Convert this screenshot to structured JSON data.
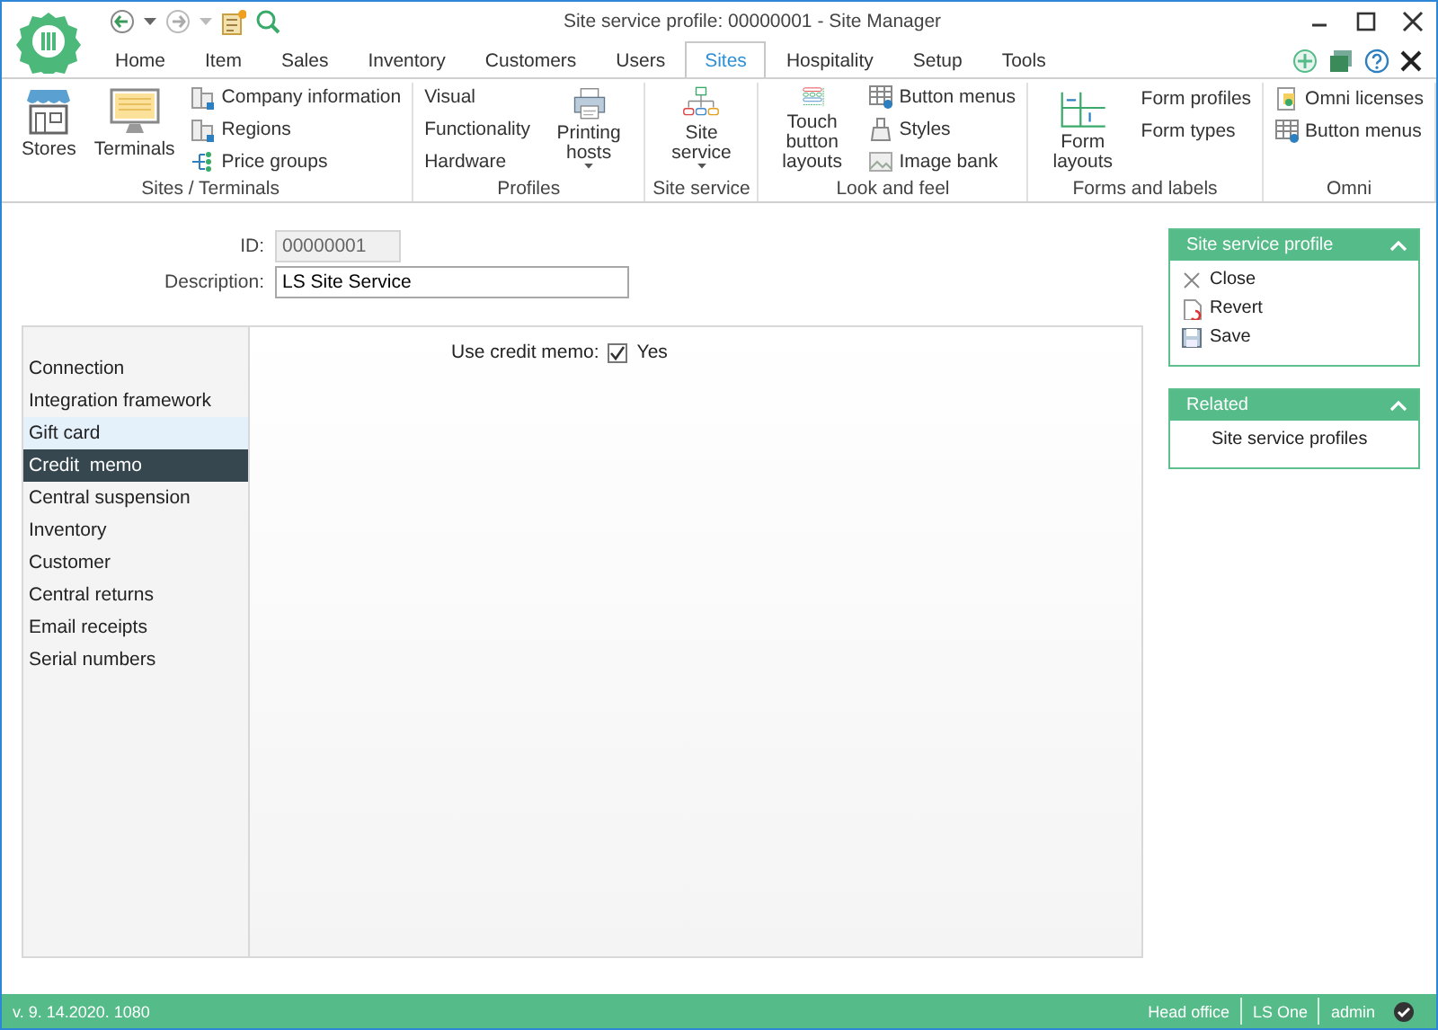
{
  "window": {
    "title": "Site service profile: 00000001 - Site Manager"
  },
  "menu_tabs": [
    {
      "label": "Home",
      "selected": false
    },
    {
      "label": "Item",
      "selected": false
    },
    {
      "label": "Sales",
      "selected": false
    },
    {
      "label": "Inventory",
      "selected": false
    },
    {
      "label": "Customers",
      "selected": false
    },
    {
      "label": "Users",
      "selected": false
    },
    {
      "label": "Sites",
      "selected": true
    },
    {
      "label": "Hospitality",
      "selected": false
    },
    {
      "label": "Setup",
      "selected": false
    },
    {
      "label": "Tools",
      "selected": false
    }
  ],
  "ribbon": {
    "groups": [
      {
        "label": "Sites / Terminals",
        "items": [
          {
            "kind": "large",
            "label": "Stores",
            "dropdown": false
          },
          {
            "kind": "large",
            "label": "Terminals",
            "dropdown": false
          },
          {
            "kind": "stack",
            "labels": [
              "Company information",
              "Regions",
              "Price groups"
            ]
          }
        ]
      },
      {
        "label": "Profiles",
        "items": [
          {
            "kind": "stack",
            "labels": [
              "Visual",
              "Functionality",
              "Hardware"
            ]
          },
          {
            "kind": "large",
            "label": "Printing hosts",
            "dropdown": true
          }
        ]
      },
      {
        "label": "Site service",
        "items": [
          {
            "kind": "large",
            "label": "Site service",
            "dropdown": true
          }
        ]
      },
      {
        "label": "Look and feel",
        "items": [
          {
            "kind": "large",
            "label": "Touch button layouts",
            "dropdown": false
          },
          {
            "kind": "stack",
            "labels": [
              "Button menus",
              "Styles",
              "Image bank"
            ]
          }
        ]
      },
      {
        "label": "Forms and labels",
        "items": [
          {
            "kind": "large",
            "label": "Form layouts",
            "dropdown": false
          },
          {
            "kind": "stack",
            "labels": [
              "Form profiles",
              "Form types"
            ]
          }
        ]
      },
      {
        "label": "Omni",
        "items": [
          {
            "kind": "stack",
            "labels": [
              "Omni licenses",
              "Button menus"
            ]
          }
        ]
      }
    ]
  },
  "form": {
    "fields": [
      {
        "label": "ID:",
        "value": "00000001",
        "disabled": true
      },
      {
        "label": "Description:",
        "value": "LS Site Service",
        "disabled": false
      }
    ]
  },
  "nav": [
    {
      "label": "Connection",
      "selected": false,
      "hovered": false
    },
    {
      "label": "Integration framework",
      "selected": false,
      "hovered": false
    },
    {
      "label": "Gift card",
      "selected": false,
      "hovered": true
    },
    {
      "label": "Credit  memo",
      "selected": true,
      "hovered": false
    },
    {
      "label": "Central suspension",
      "selected": false,
      "hovered": false
    },
    {
      "label": "Inventory",
      "selected": false,
      "hovered": false
    },
    {
      "label": "Customer",
      "selected": false,
      "hovered": false
    },
    {
      "label": "Central returns",
      "selected": false,
      "hovered": false
    },
    {
      "label": "Email receipts",
      "selected": false,
      "hovered": false
    },
    {
      "label": "Serial numbers",
      "selected": false,
      "hovered": false
    }
  ],
  "settings": [
    {
      "label": "Use credit memo:",
      "checked": true,
      "text": "Yes"
    }
  ],
  "side_panels": [
    {
      "title": "Site service profile",
      "expanded": true,
      "items": [
        {
          "kind": "close",
          "label": "Close"
        },
        {
          "kind": "revert",
          "label": "Revert"
        },
        {
          "kind": "save",
          "label": "Save"
        }
      ]
    },
    {
      "title": "Related",
      "expanded": true,
      "items": [
        {
          "kind": "link",
          "label": "Site service profiles"
        }
      ]
    }
  ],
  "status_bar": {
    "version": "v. 9. 14.2020. 1080",
    "items": [
      "Head office",
      "LS One",
      "admin"
    ]
  }
}
